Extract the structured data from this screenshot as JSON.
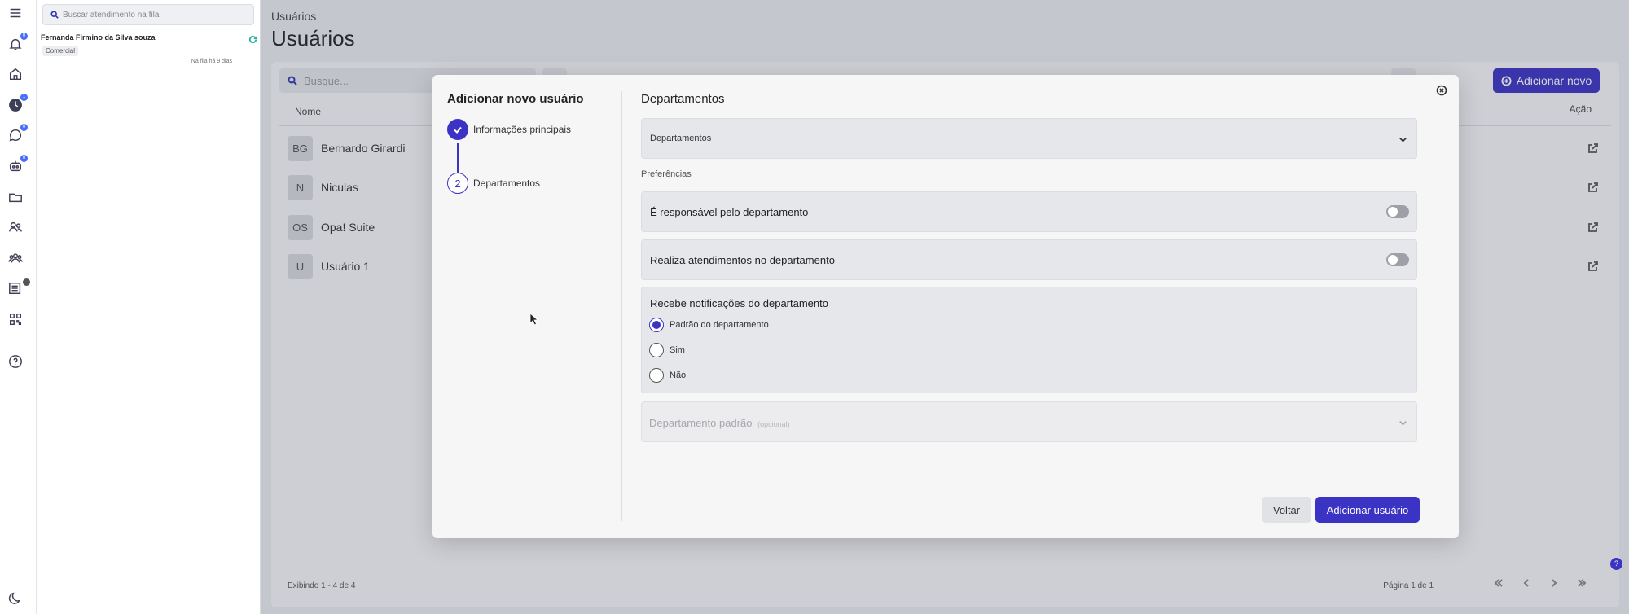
{
  "queue": {
    "search_placeholder": "Buscar atendimento na fila",
    "item": {
      "name": "Fernanda Firmino da Silva souza",
      "tag": "Comercial",
      "time": "Na fila há 9 dias"
    }
  },
  "rail": {
    "badges": {
      "notifications": "0",
      "history": "1",
      "chats": "0",
      "bots": "0"
    }
  },
  "page": {
    "breadcrumb": "Usuários",
    "title": "Usuários",
    "search_placeholder": "Busque...",
    "add_new_label": "Adicionar novo",
    "col_name": "Nome",
    "col_action": "Ação",
    "users": [
      {
        "initials": "BG",
        "name": "Bernardo Girardi"
      },
      {
        "initials": "N",
        "name": "Niculas"
      },
      {
        "initials": "OS",
        "name": "Opa! Suite"
      },
      {
        "initials": "U",
        "name": "Usuário 1"
      }
    ],
    "footer_showing": "Exibindo 1 - 4 de 4",
    "footer_page": "Página 1 de 1",
    "help": "?"
  },
  "modal": {
    "title": "Adicionar novo usuário",
    "steps": [
      {
        "label": "Informações principais",
        "state": "done"
      },
      {
        "number": "2",
        "label": "Departamentos",
        "state": "active"
      }
    ],
    "section_title": "Departamentos",
    "dept_select_value": "Departamentos",
    "preferences_label": "Preferências",
    "toggle_responsible": "É responsável pelo departamento",
    "toggle_attends": "Realiza atendimentos no departamento",
    "notifications_title": "Recebe notificações do departamento",
    "radio_options": [
      "Padrão do departamento",
      "Sim",
      "Não"
    ],
    "radio_selected": "Padrão do departamento",
    "default_dept_label": "Departamento padrão",
    "default_dept_optional": "(opcional)",
    "back_label": "Voltar",
    "submit_label": "Adicionar usuário"
  },
  "colors": {
    "accent": "#3b33c4",
    "sync": "#2bb3a0"
  }
}
